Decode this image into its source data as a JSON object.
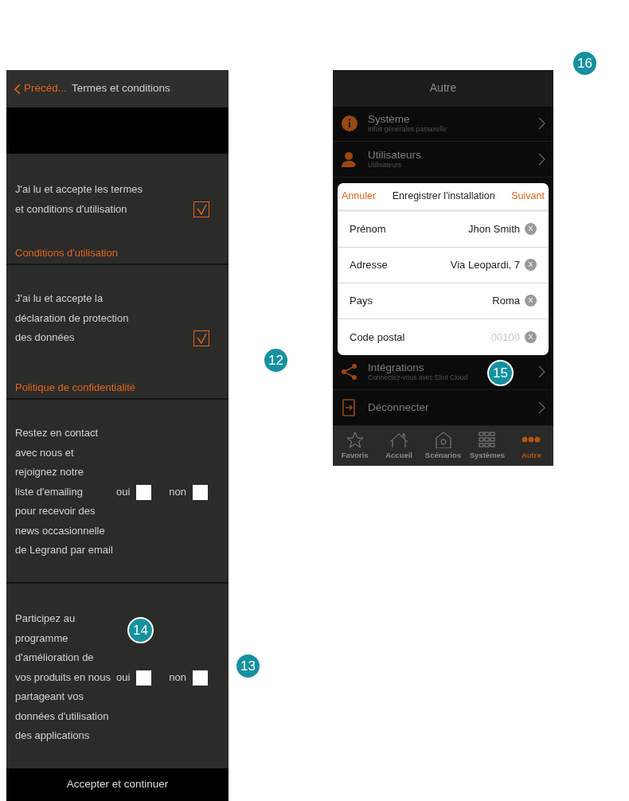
{
  "left_screen": {
    "header": {
      "back": "Précéd...",
      "title": "Termes et conditions"
    },
    "sections": [
      {
        "kind": "consent",
        "lines": [
          "J'ai lu et accepte les termes",
          "et conditions d'utilisation"
        ],
        "checked": true,
        "link": "Conditions d'utilisation"
      },
      {
        "kind": "consent",
        "lines": [
          "J'ai lu et accepte la",
          "déclaration de protection",
          "des données"
        ],
        "checked": true,
        "link": "Politique de confidentialité"
      },
      {
        "kind": "choice",
        "lines": [
          "Restez en contact",
          "avec nous et",
          "rejoignez notre",
          "liste d'emailing",
          "pour recevoir des",
          "news occasionnelle",
          "de Legrand par email"
        ],
        "options": [
          {
            "label": "oui",
            "checked": false
          },
          {
            "label": "non",
            "checked": false
          }
        ]
      },
      {
        "kind": "choice",
        "lines": [
          "Participez au",
          "programme",
          "d'amélioration de",
          "vos produits en nous",
          "partageant vos",
          "données d'utilisation",
          "des applications"
        ],
        "options": [
          {
            "label": "oui",
            "checked": false
          },
          {
            "label": "non",
            "checked": false
          }
        ]
      }
    ],
    "footer_button": "Accepter et continuer"
  },
  "right_screen": {
    "header": "Autre",
    "menu": [
      {
        "title": "Système",
        "subtitle": "Infos générales passerelle"
      },
      {
        "title": "Utilisateurs",
        "subtitle": "Utilisateurs"
      },
      {
        "title": "Intégrations",
        "subtitle": "Connectez-vous avec Eliot Cloud"
      },
      {
        "title": "Déconnecter"
      }
    ],
    "dialog": {
      "cancel": "Annuler",
      "title": "Enregistrer l'installation",
      "next": "Suivant",
      "fields": [
        {
          "label": "Prénom",
          "value": "Jhon Smith",
          "clear": "X"
        },
        {
          "label": "Adresse",
          "value": "Via Leopardi, 7",
          "clear": "X"
        },
        {
          "label": "Pays",
          "value": "Roma",
          "clear": "X"
        },
        {
          "label": "Code postal",
          "placeholder": "00100",
          "clear": "X"
        }
      ]
    },
    "tabs": [
      {
        "label": "Favoris",
        "selected": false
      },
      {
        "label": "Accueil",
        "selected": false
      },
      {
        "label": "Scénarios",
        "selected": false
      },
      {
        "label": "Systèmes",
        "selected": false
      },
      {
        "label": "Autre",
        "selected": true
      }
    ]
  },
  "steps": [
    "12",
    "13",
    "14",
    "15",
    "16"
  ]
}
